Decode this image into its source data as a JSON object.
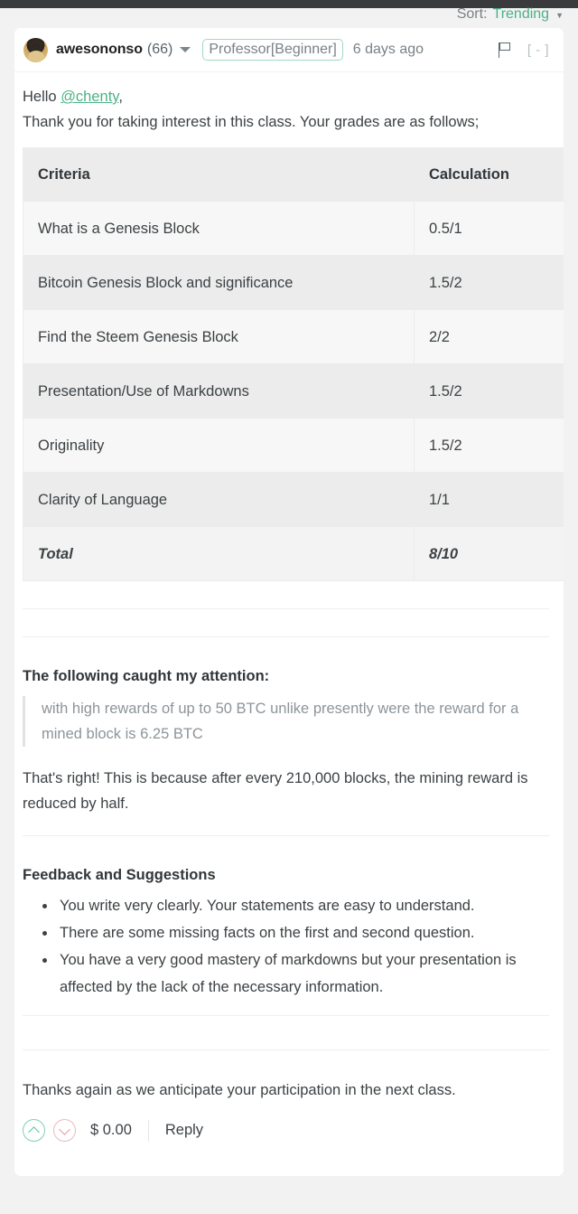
{
  "topbar": {
    "visible": true
  },
  "sort": {
    "label": "Sort:",
    "value": "Trending",
    "caret": "▼"
  },
  "comment": {
    "author": "awesononso",
    "reputation": "(66)",
    "badge": "Professor[Beginner]",
    "timeago": "6 days ago",
    "collapse": "[ - ]",
    "greeting_prefix": "Hello ",
    "mention": "@chenty",
    "greeting_suffix": ",",
    "intro": "Thank you for taking interest in this class. Your grades are as follows;",
    "attention_title": "The following caught my attention:",
    "quote": "with high rewards of up to 50 BTC unlike presently were the reward for a mined block is 6.25 BTC",
    "response": "That's right! This is because after every 210,000 blocks, the mining reward is reduced by half.",
    "feedback_title": "Feedback and Suggestions",
    "feedback_items": [
      "You write very clearly. Your statements are easy to understand.",
      "There are some missing facts on the first and second question.",
      "You have a very good mastery of markdowns but your presentation is affected by the lack of the necessary information."
    ],
    "closing": "Thanks again as we anticipate your participation in the next class."
  },
  "grades_table": {
    "headers": [
      "Criteria",
      "Calculation"
    ],
    "rows": [
      {
        "criteria": "What is a Genesis Block",
        "calculation": "0.5/1"
      },
      {
        "criteria": "Bitcoin Genesis Block and significance",
        "calculation": "1.5/2"
      },
      {
        "criteria": "Find the Steem Genesis Block",
        "calculation": "2/2"
      },
      {
        "criteria": "Presentation/Use of Markdowns",
        "calculation": "1.5/2"
      },
      {
        "criteria": "Originality",
        "calculation": "1.5/2"
      },
      {
        "criteria": "Clarity of Language",
        "calculation": "1/1"
      }
    ],
    "total": {
      "criteria": "Total",
      "calculation": "8/10"
    }
  },
  "footer": {
    "payout": "$ 0.00",
    "reply": "Reply"
  },
  "colors": {
    "accent_green": "#4bb286",
    "upvote": "#7fd0ae",
    "downvote": "#edb8bd",
    "text": "#3c4144",
    "muted": "#788187",
    "topbar": "#3a3b3c"
  }
}
